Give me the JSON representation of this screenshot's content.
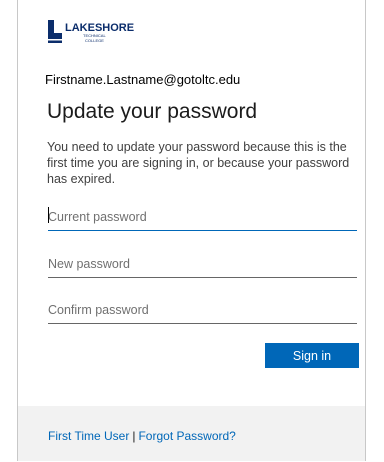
{
  "brand": {
    "name": "LAKESHORE",
    "sub1": "TECHNICAL",
    "sub2": "COLLEGE",
    "logo_color": "#0b2d6b"
  },
  "account": {
    "email": "Firstname.Lastname@gotoltc.edu"
  },
  "page": {
    "title": "Update your password",
    "description": "You need to update your password because this is the first time you are signing in, or because your password has expired."
  },
  "form": {
    "current_password": {
      "placeholder": "Current password",
      "value": ""
    },
    "new_password": {
      "placeholder": "New password",
      "value": ""
    },
    "confirm_password": {
      "placeholder": "Confirm password",
      "value": ""
    },
    "submit_label": "Sign in"
  },
  "footer": {
    "link1": "First Time User",
    "separator": "|",
    "link2": "Forgot Password?"
  },
  "colors": {
    "accent": "#0067b8",
    "footer_bg": "#f2f2f2"
  }
}
